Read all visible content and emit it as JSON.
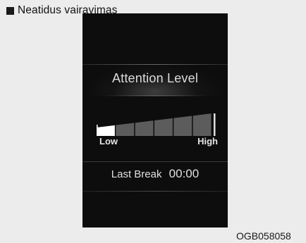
{
  "caption": {
    "text": "Neatidus vairavimas"
  },
  "display": {
    "title": "Attention Level",
    "scale": {
      "low_label": "Low",
      "high_label": "High",
      "segments": 6,
      "filled_segments": 1
    },
    "last_break": {
      "label": "Last Break",
      "value": "00:00"
    },
    "colors": {
      "background": "#0d0d0d",
      "bar_filled": "#ffffff",
      "bar_empty": "#5c5c5c"
    }
  },
  "figure_code": "OGB058058"
}
